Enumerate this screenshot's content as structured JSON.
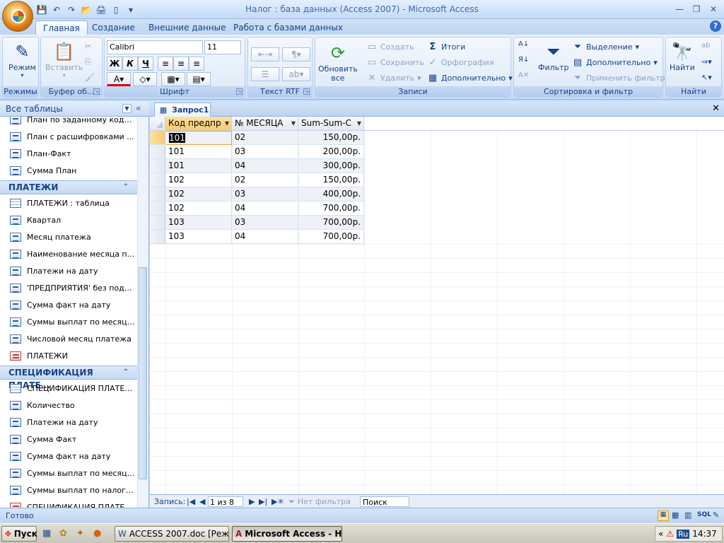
{
  "window": {
    "title": "Налог : база данных (Access 2007) - Microsoft Access"
  },
  "ribbon_tabs": [
    "Главная",
    "Создание",
    "Внешние данные",
    "Работа с базами данных"
  ],
  "ribbon": {
    "view": {
      "label": "Режим",
      "group": "Режимы"
    },
    "clipboard": {
      "paste": "Вставить",
      "group": "Буфер об...",
      "group_full": "Буфер обмена"
    },
    "font": {
      "name": "Calibri",
      "size": "11",
      "bold": "Ж",
      "italic": "К",
      "underline": "Ч",
      "color_letter": "А",
      "group": "Шрифт"
    },
    "rtf": {
      "group": "Текст RTF"
    },
    "records": {
      "refresh": "Обновить",
      "refresh2": "все",
      "new": "Создать",
      "save": "Сохранить",
      "delete": "Удалить",
      "totals": "Итоги",
      "spelling": "Орфография",
      "more": "Дополнительно",
      "group": "Записи"
    },
    "sort": {
      "filter": "Фильтр",
      "selection": "Выделение",
      "advanced": "Дополнительно",
      "toggle": "Применить фильтр",
      "group": "Сортировка и фильтр"
    },
    "find": {
      "find": "Найти",
      "group": "Найти"
    }
  },
  "nav": {
    "title": "Все таблицы",
    "items_top": [
      {
        "label": "План по заданному коду ...",
        "icon": "query"
      },
      {
        "label": "План с расшифровками ...",
        "icon": "query"
      },
      {
        "label": "План-Факт",
        "icon": "query"
      },
      {
        "label": "Сумма План",
        "icon": "query"
      }
    ],
    "group1": {
      "title": "ПЛАТЕЖИ",
      "items": [
        {
          "label": "ПЛАТЕЖИ : таблица",
          "icon": "table"
        },
        {
          "label": "Квартал",
          "icon": "query"
        },
        {
          "label": "Месяц платежа",
          "icon": "query"
        },
        {
          "label": "Наименование месяца п...",
          "icon": "query"
        },
        {
          "label": "Платежи на дату",
          "icon": "query"
        },
        {
          "label": "'ПРЕДПРИЯТИЯ' без подч...",
          "icon": "query"
        },
        {
          "label": "Сумма факт на дату",
          "icon": "query"
        },
        {
          "label": "Суммы выплат по месяцам",
          "icon": "query"
        },
        {
          "label": "Числовой месяц платежа",
          "icon": "query"
        },
        {
          "label": "ПЛАТЕЖИ",
          "icon": "form"
        }
      ]
    },
    "group2": {
      "title": "СПЕЦИФИКАЦИЯ ПЛАТЕ...",
      "items": [
        {
          "label": "СПЕЦИФИКАЦИЯ ПЛАТЕЖ...",
          "icon": "table"
        },
        {
          "label": "Количество",
          "icon": "query"
        },
        {
          "label": "Платежи на дату",
          "icon": "query"
        },
        {
          "label": "Сумма Факт",
          "icon": "query"
        },
        {
          "label": "Сумма факт на дату",
          "icon": "query"
        },
        {
          "label": "Суммы выплат по месяцам",
          "icon": "query"
        },
        {
          "label": "Суммы выплат по налогам",
          "icon": "query"
        },
        {
          "label": "СПЕЦИФИКАЦИЯ ПЛАТЕЖ...",
          "icon": "form"
        }
      ]
    }
  },
  "document": {
    "tab": "Запрос1",
    "columns": [
      "Код предпр",
      "№ МЕСЯЦА",
      "Sum-Sum-C"
    ],
    "rows": [
      [
        "101",
        "02",
        "150,00р."
      ],
      [
        "101",
        "03",
        "200,00р."
      ],
      [
        "101",
        "04",
        "300,00р."
      ],
      [
        "102",
        "02",
        "150,00р."
      ],
      [
        "102",
        "03",
        "400,00р."
      ],
      [
        "102",
        "04",
        "700,00р."
      ],
      [
        "103",
        "03",
        "700,00р."
      ],
      [
        "103",
        "04",
        "700,00р."
      ]
    ],
    "record_nav": {
      "label": "Запись:",
      "position": "1 из 8",
      "filter": "Нет фильтра",
      "search": "Поиск"
    }
  },
  "status": {
    "text": "Готово",
    "sql": "SQL"
  },
  "taskbar": {
    "start": "Пуск",
    "tasks": [
      "ACCESS 2007.doc [Режи...",
      "Microsoft Access - На..."
    ],
    "lang": "Ru",
    "clock": "14:37"
  }
}
